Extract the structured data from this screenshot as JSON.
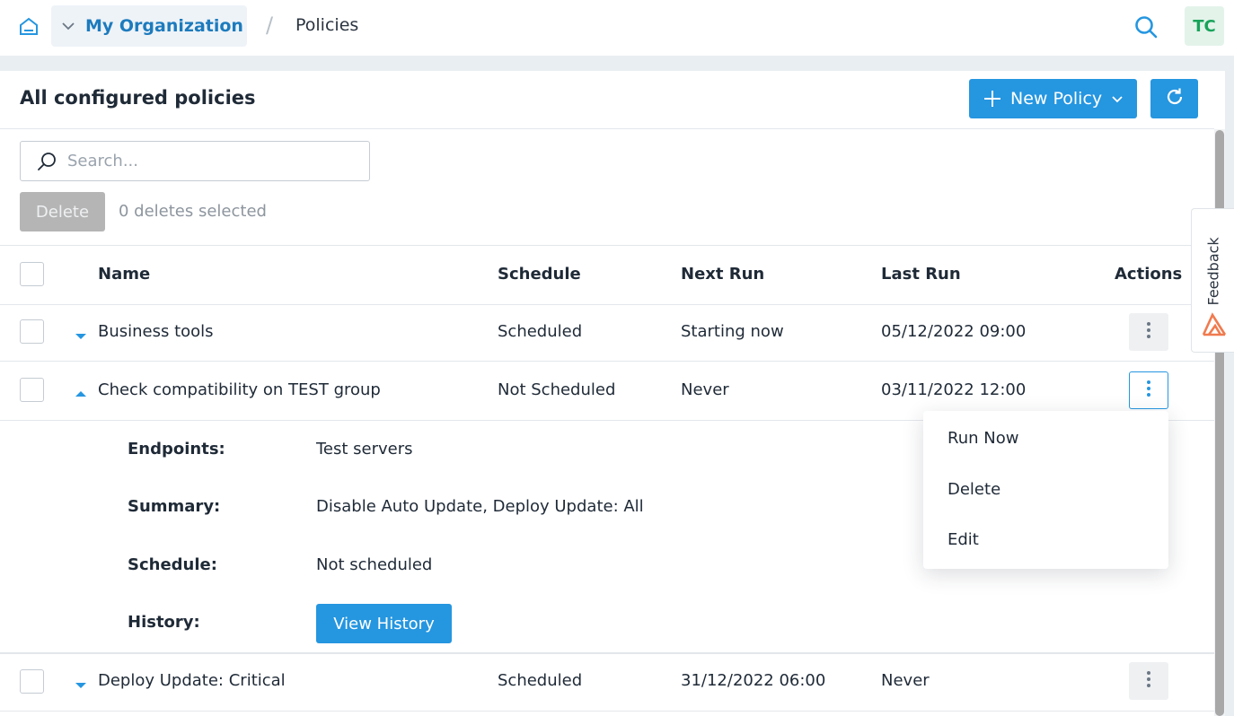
{
  "topbar": {
    "org_label": "My Organization",
    "separator": "/",
    "current_page": "Policies",
    "avatar_initials": "TC"
  },
  "panel": {
    "title": "All configured policies",
    "new_policy_label": "New Policy",
    "search_placeholder": "Search...",
    "delete_label": "Delete",
    "selected_count_text": "0 deletes selected"
  },
  "table": {
    "columns": [
      "Name",
      "Schedule",
      "Next Run",
      "Last Run",
      "Actions"
    ],
    "rows": [
      {
        "name": "Business tools",
        "schedule": "Scheduled",
        "next_run": "Starting now",
        "last_run": "05/12/2022 09:00",
        "expanded": false
      },
      {
        "name": "Check compatibility on TEST group",
        "schedule": "Not Scheduled",
        "next_run": "Never",
        "last_run": "03/11/2022 12:00",
        "expanded": true
      },
      {
        "name": "Deploy Update: Critical",
        "schedule": "Scheduled",
        "next_run": "31/12/2022 06:00",
        "last_run": "Never",
        "expanded": false
      }
    ]
  },
  "details": {
    "endpoints_label": "Endpoints:",
    "endpoints_value": "Test servers",
    "summary_label": "Summary:",
    "summary_value": "Disable Auto Update, Deploy Update: All",
    "schedule_label": "Schedule:",
    "schedule_value": "Not scheduled",
    "history_label": "History:",
    "view_history_label": "View History"
  },
  "actions_menu": {
    "items": [
      "Run Now",
      "Delete",
      "Edit"
    ]
  },
  "feedback": {
    "label": "Feedback"
  },
  "colors": {
    "accent": "#2596e0",
    "org_text": "#1d7bbd",
    "avatar_text": "#19a35a",
    "disabled_button": "#b5b5b5",
    "feedback_logo": "#f07b4f"
  },
  "icons": [
    "home-icon",
    "chevron-down-icon",
    "search-icon",
    "plus-icon",
    "refresh-icon",
    "kebab-icon",
    "caret-down-icon",
    "caret-up-icon",
    "feedback-logo-icon"
  ]
}
